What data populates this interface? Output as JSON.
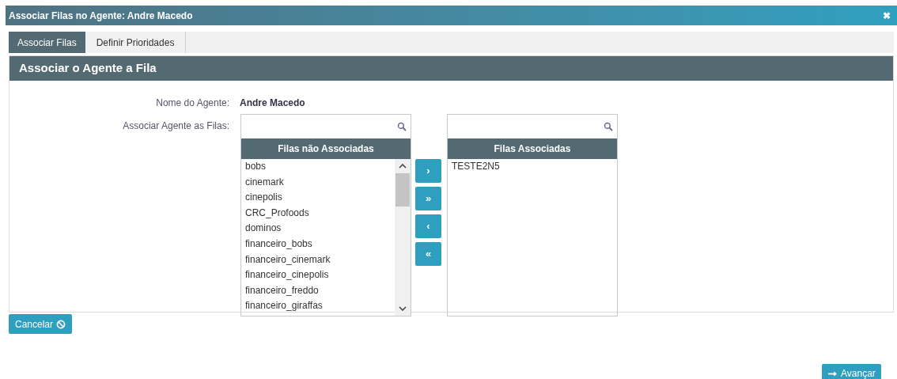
{
  "window": {
    "title": "Associar Filas no Agente: Andre Macedo",
    "close": "✖"
  },
  "tabs": [
    {
      "label": "Associar Filas",
      "selected": true
    },
    {
      "label": "Definir Prioridades",
      "selected": false
    }
  ],
  "section_title": "Associar o Agente a Fila",
  "agent": {
    "label": "Nome do Agente:",
    "value": "Andre Macedo"
  },
  "assign_label": "Associar Agente as Filas:",
  "lists": [
    {
      "header": "Filas não Associadas",
      "scrollbar": true,
      "items": [
        "bobs",
        "cinemark",
        "cinepolis",
        "CRC_Profoods",
        "dominos",
        "financeiro_bobs",
        "financeiro_cinemark",
        "financeiro_cinepolis",
        "financeiro_freddo",
        "financeiro_giraffas"
      ]
    },
    {
      "header": "Filas Associadas",
      "scrollbar": false,
      "items": [
        "TESTE2N5"
      ]
    }
  ],
  "move_buttons": [
    "›",
    "»",
    "‹",
    "«"
  ],
  "cancel": "Cancelar",
  "next": "Avançar"
}
